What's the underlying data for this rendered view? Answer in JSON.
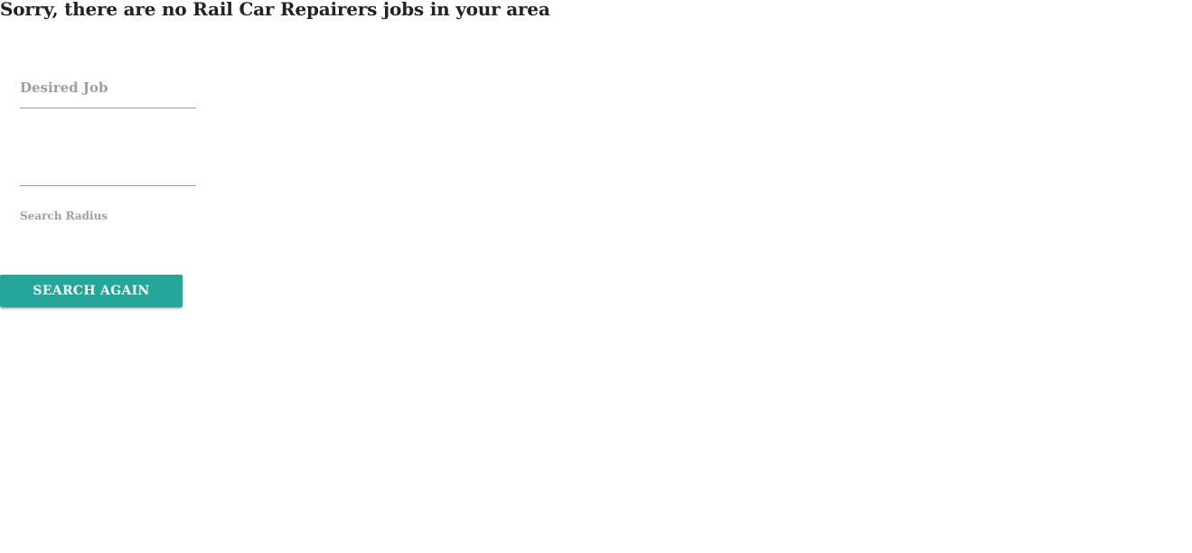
{
  "page": {
    "title": "Sorry, there are no Rail Car Repairers jobs in your area"
  },
  "form": {
    "desired_job": {
      "placeholder": "Desired Job",
      "value": ""
    },
    "location": {
      "placeholder": "",
      "value": ""
    },
    "search_radius": {
      "label": "Search Radius"
    },
    "search_button_label": "SEARCH AGAIN"
  },
  "colors": {
    "accent": "#26a69a",
    "muted_text": "#9e9e9e",
    "heading_text": "#222222"
  }
}
